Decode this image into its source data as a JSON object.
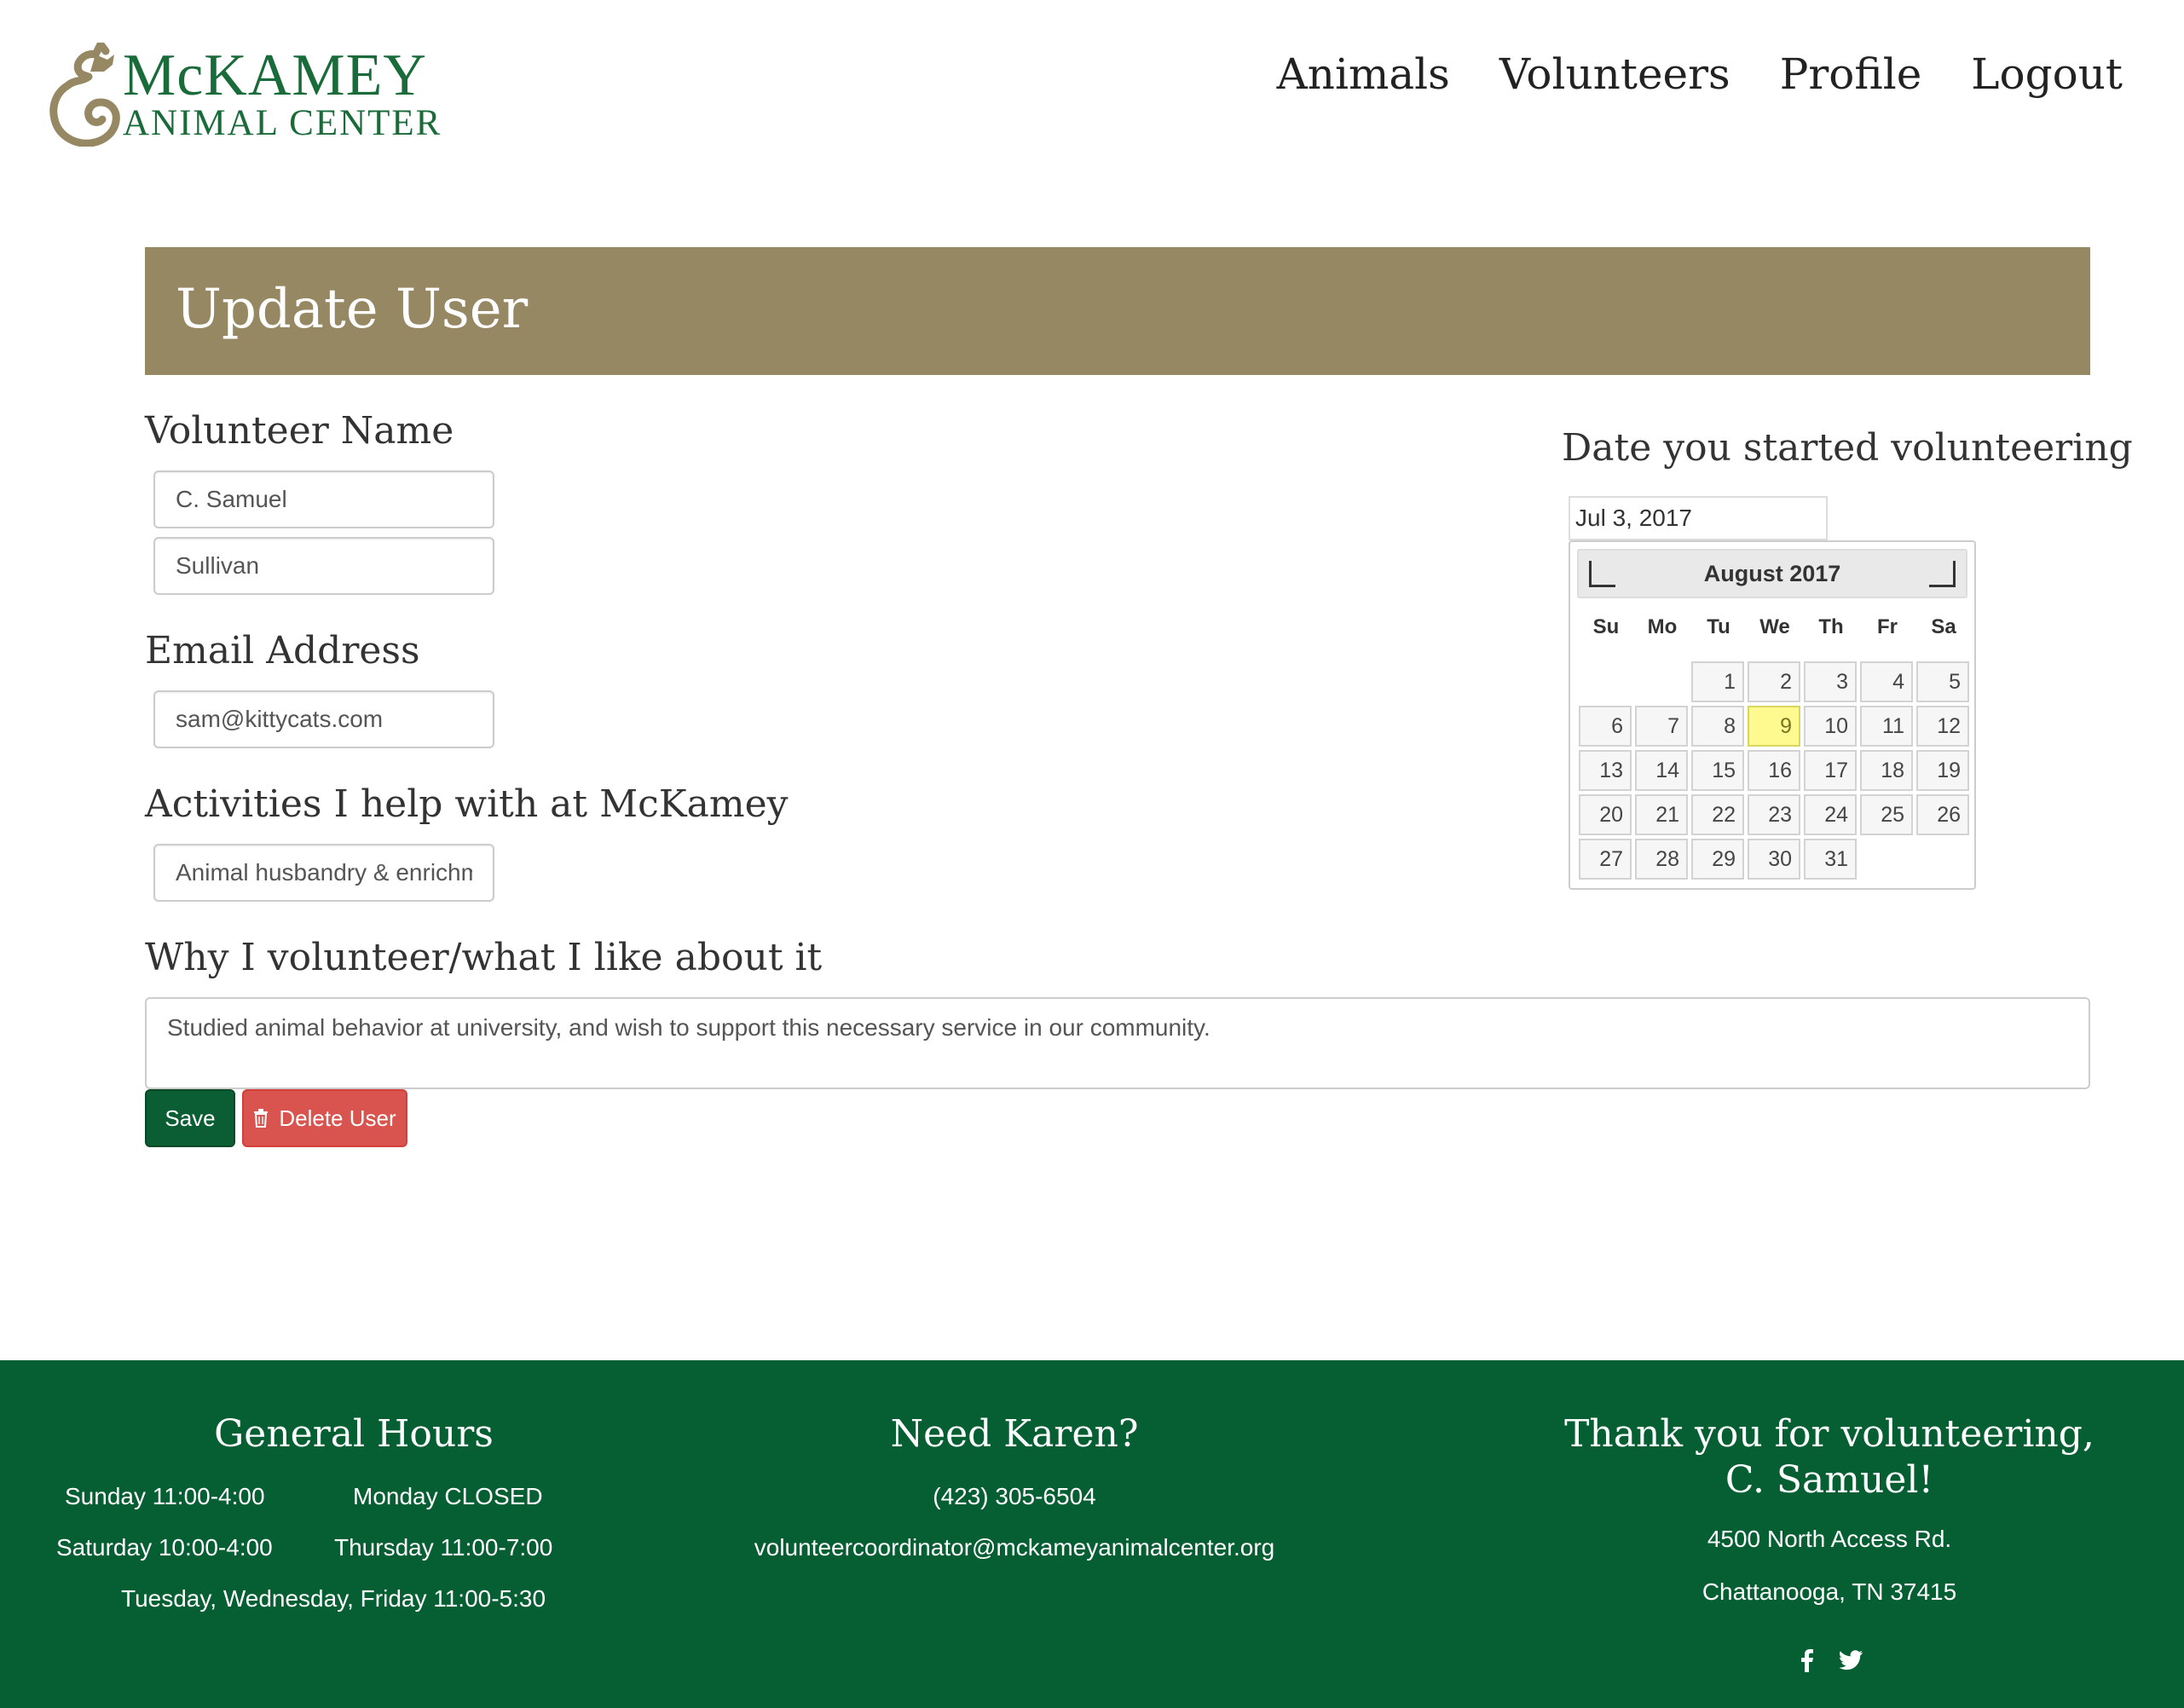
{
  "brand": {
    "logo_line1": "McKAMEY",
    "logo_line2": "ANIMAL CENTER"
  },
  "nav": {
    "items": [
      "Animals",
      "Volunteers",
      "Profile",
      "Logout"
    ]
  },
  "page": {
    "title": "Update User"
  },
  "form": {
    "name_label": "Volunteer Name",
    "first_name": "C. Samuel",
    "last_name": "Sullivan",
    "email_label": "Email Address",
    "email": "sam@kittycats.com",
    "activities_label": "Activities I help with at McKamey",
    "activities": "Animal husbandry & enrichment",
    "why_label": "Why I volunteer/what I like about it",
    "why": "Studied animal behavior at university, and wish to support this necessary service in our community.",
    "save_label": "Save",
    "delete_label": "Delete User",
    "delete_icon": "trash-icon"
  },
  "start_date": {
    "label": "Date you started volunteering",
    "value": "Jul 3, 2017",
    "calendar": {
      "month_label": "August 2017",
      "weekdays": [
        "Su",
        "Mo",
        "Tu",
        "We",
        "Th",
        "Fr",
        "Sa"
      ],
      "leading_blanks": 2,
      "days": 31,
      "highlighted_day": 9
    }
  },
  "footer": {
    "hours_title": "General Hours",
    "hours_sunday": "Sunday 11:00-4:00",
    "hours_monday": "Monday CLOSED",
    "hours_saturday": "Saturday 10:00-4:00",
    "hours_thursday": "Thursday 11:00-7:00",
    "hours_tue_wed_fri": "Tuesday, Wednesday, Friday 11:00-5:30",
    "contact_title": "Need Karen?",
    "phone": "(423) 305-6504",
    "contact_email": "volunteercoordinator@mckameyanimalcenter.org",
    "thanks_title": "Thank you for volunteering, C. Samuel!",
    "address_line1": "4500 North Access Rd.",
    "address_line2": "Chattanooga, TN 37415",
    "social_icons": [
      "facebook-icon",
      "twitter-icon"
    ]
  },
  "colors": {
    "banner": "#968862",
    "brand_green": "#055f33",
    "save_button": "#0b5e33",
    "delete_button": "#d9534f",
    "highlight_day": "#fffa90"
  }
}
